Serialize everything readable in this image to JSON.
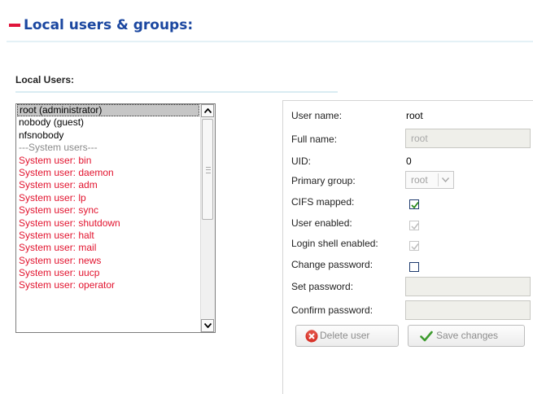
{
  "header": {
    "title": "Local users & groups:"
  },
  "local_users": {
    "label": "Local Users:",
    "items": [
      {
        "text": "root (administrator)",
        "kind": "selected"
      },
      {
        "text": "nobody (guest)",
        "kind": "normal"
      },
      {
        "text": "nfsnobody",
        "kind": "normal"
      },
      {
        "text": "---System users---",
        "kind": "separator"
      },
      {
        "text": "System user: bin",
        "kind": "system"
      },
      {
        "text": "System user: daemon",
        "kind": "system"
      },
      {
        "text": "System user: adm",
        "kind": "system"
      },
      {
        "text": "System user: lp",
        "kind": "system"
      },
      {
        "text": "System user: sync",
        "kind": "system"
      },
      {
        "text": "System user: shutdown",
        "kind": "system"
      },
      {
        "text": "System user: halt",
        "kind": "system"
      },
      {
        "text": "System user: mail",
        "kind": "system"
      },
      {
        "text": "System user: news",
        "kind": "system"
      },
      {
        "text": "System user: uucp",
        "kind": "system"
      },
      {
        "text": "System user: operator",
        "kind": "system"
      }
    ]
  },
  "details": {
    "user_name_label": "User name:",
    "user_name_value": "root",
    "full_name_label": "Full name:",
    "full_name_value": "root",
    "uid_label": "UID:",
    "uid_value": "0",
    "primary_group_label": "Primary group:",
    "primary_group_value": "root",
    "cifs_mapped_label": "CIFS mapped:",
    "cifs_mapped_checked": true,
    "user_enabled_label": "User enabled:",
    "user_enabled_checked": true,
    "login_shell_label": "Login shell enabled:",
    "login_shell_checked": true,
    "change_password_label": "Change password:",
    "change_password_checked": false,
    "set_password_label": "Set password:",
    "confirm_password_label": "Confirm password:"
  },
  "actions": {
    "delete_label": "Delete user",
    "save_label": "Save changes"
  },
  "colors": {
    "title": "#1b47a0",
    "accent_red": "#e0153b",
    "system_user": "#e2132e",
    "check_green": "#2a8a1c"
  }
}
